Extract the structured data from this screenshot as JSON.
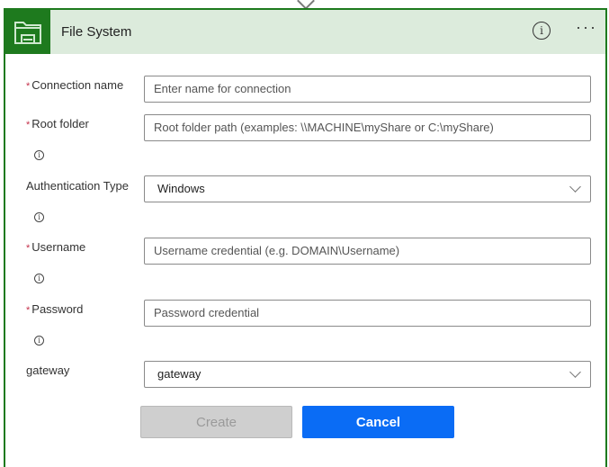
{
  "header": {
    "title": "File System",
    "icon": "folder-icon",
    "info_icon": "info-icon",
    "more_label": "···"
  },
  "form": {
    "connection_name": {
      "label": "Connection name",
      "required": "*",
      "placeholder": "Enter name for connection"
    },
    "root_folder": {
      "label": "Root folder",
      "required": "*",
      "placeholder": "Root folder path (examples: \\\\MACHINE\\myShare or C:\\myShare)"
    },
    "auth_type": {
      "label": "Authentication Type",
      "value": "Windows"
    },
    "username": {
      "label": "Username",
      "required": "*",
      "placeholder": "Username credential (e.g. DOMAIN\\Username)"
    },
    "password": {
      "label": "Password",
      "required": "*",
      "placeholder": "Password credential"
    },
    "gateway": {
      "label": "gateway",
      "value": "gateway"
    },
    "info_glyph": "i"
  },
  "buttons": {
    "create": "Create",
    "cancel": "Cancel"
  },
  "colors": {
    "accent": "#1e7a1e",
    "header_bg": "#dcebdc",
    "primary": "#0a6cf5",
    "required": "#c4314b"
  }
}
